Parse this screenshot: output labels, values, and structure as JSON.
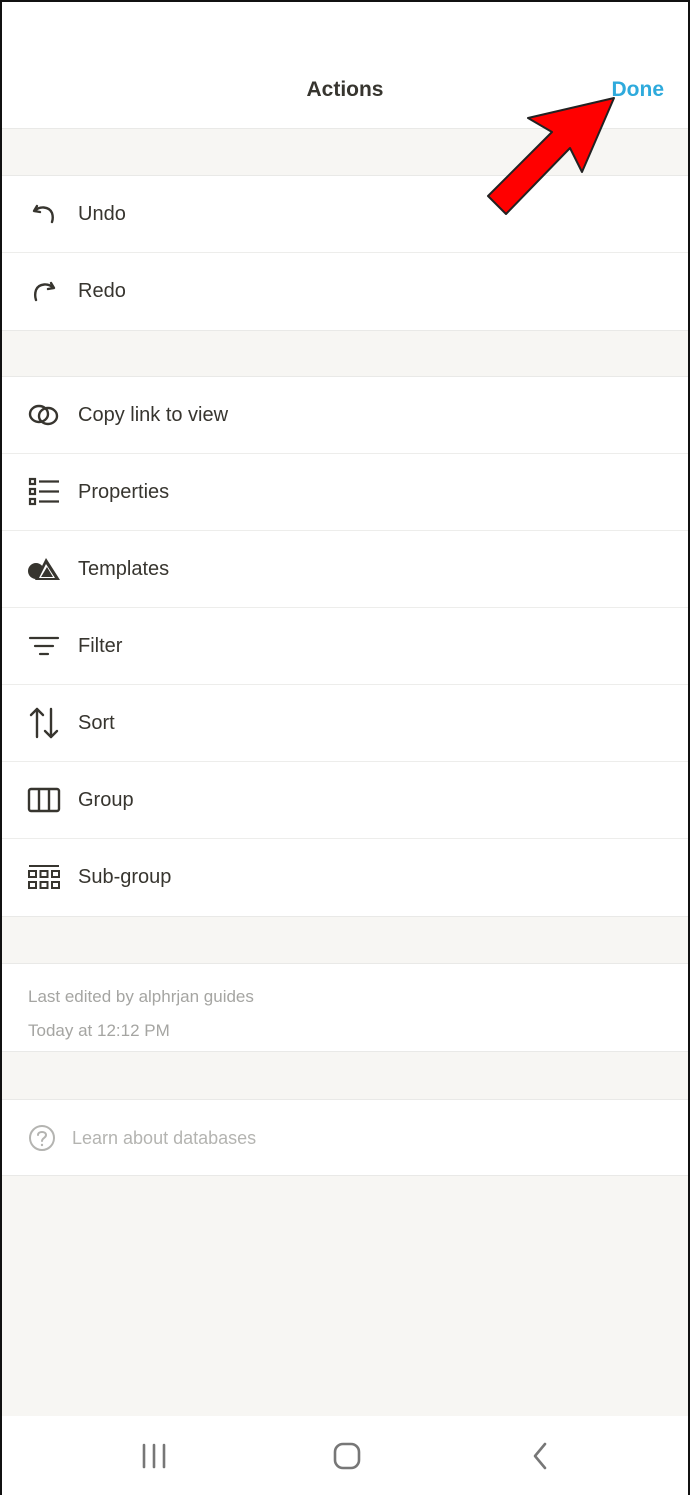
{
  "header": {
    "title": "Actions",
    "done_label": "Done"
  },
  "history_group": [
    {
      "label": "Undo",
      "icon": "undo-icon"
    },
    {
      "label": "Redo",
      "icon": "redo-icon"
    }
  ],
  "view_group": [
    {
      "label": "Copy link to view",
      "icon": "link-icon"
    },
    {
      "label": "Properties",
      "icon": "properties-list-icon"
    },
    {
      "label": "Templates",
      "icon": "shapes-icon"
    },
    {
      "label": "Filter",
      "icon": "filter-icon"
    },
    {
      "label": "Sort",
      "icon": "sort-arrows-icon"
    },
    {
      "label": "Group",
      "icon": "columns-icon"
    },
    {
      "label": "Sub-group",
      "icon": "grid-icon"
    }
  ],
  "meta": {
    "edited_by": "Last edited by alphrjan guides",
    "edited_at": "Today at 12:12 PM"
  },
  "help": {
    "label": "Learn about databases",
    "icon": "help-circle-icon"
  },
  "annotation": {
    "arrow_color": "#ff0000"
  },
  "colors": {
    "accent": "#2eaadc",
    "background": "#f7f6f3",
    "text": "#37352f",
    "muted": "#a5a5a2"
  }
}
